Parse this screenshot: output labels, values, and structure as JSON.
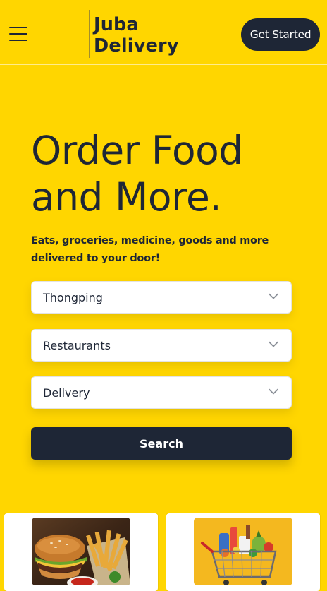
{
  "header": {
    "menu_icon": "hamburger-menu-icon",
    "brand_line1": "Juba",
    "brand_line2": "Delivery",
    "cta_label": "Get Started"
  },
  "hero": {
    "title_line1": "Order Food",
    "title_line2": "and More.",
    "subtitle": "Eats, groceries, medicine, goods and more delivered to your door!"
  },
  "form": {
    "location": {
      "value": "Thongping",
      "icon": "chevron-down-icon"
    },
    "category": {
      "value": "Restaurants",
      "icon": "chevron-down-icon"
    },
    "mode": {
      "value": "Delivery",
      "icon": "chevron-down-icon"
    },
    "search_label": "Search"
  },
  "cards": [
    {
      "image": "burger-fries-food-image"
    },
    {
      "image": "grocery-cart-image"
    }
  ],
  "colors": {
    "background": "#ffd600",
    "primary_dark": "#1e2636",
    "white": "#ffffff"
  }
}
